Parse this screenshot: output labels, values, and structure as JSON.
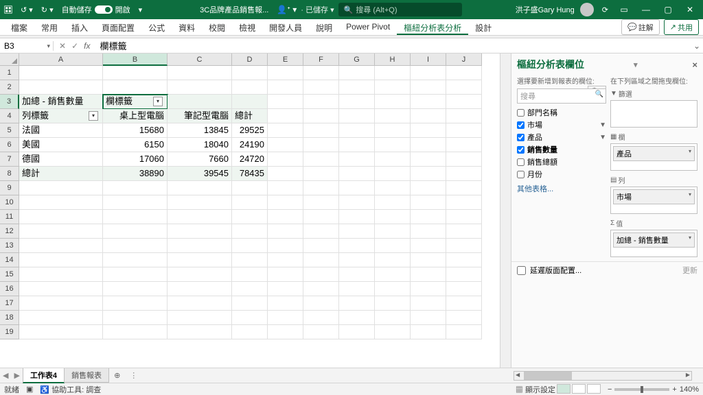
{
  "titlebar": {
    "autosave_label": "自動儲存",
    "autosave_state": "開啟",
    "filename": "3C品牌產品銷售報...",
    "saved": "已儲存",
    "search_placeholder": "搜尋 (Alt+Q)",
    "username": "洪子盛Gary Hung"
  },
  "tabs": {
    "file": "檔案",
    "home": "常用",
    "insert": "插入",
    "layout": "頁面配置",
    "formulas": "公式",
    "data": "資料",
    "review": "校閱",
    "view": "檢視",
    "developer": "開發人員",
    "help": "說明",
    "powerpivot": "Power Pivot",
    "analyze": "樞紐分析表分析",
    "design": "設計",
    "comments": "註解",
    "share": "共用"
  },
  "namebox": "B3",
  "formula": "欄標籤",
  "cols": {
    "A": {
      "w": 122
    },
    "B": {
      "w": 94
    },
    "C": {
      "w": 94
    },
    "D": {
      "w": 52
    },
    "E": {
      "w": 52
    },
    "F": {
      "w": 52
    },
    "G": {
      "w": 52
    },
    "H": {
      "w": 52
    },
    "I": {
      "w": 52
    },
    "J": {
      "w": 52
    }
  },
  "pivot": {
    "r3": {
      "a": "加總 - 銷售數量",
      "b": "欄標籤"
    },
    "r4": {
      "a": "列標籤",
      "b": "桌上型電腦",
      "c": "筆記型電腦",
      "d": "總計"
    },
    "r5": {
      "a": "法國",
      "b": "15680",
      "c": "13845",
      "d": "29525"
    },
    "r6": {
      "a": "美國",
      "b": "6150",
      "c": "18040",
      "d": "24190"
    },
    "r7": {
      "a": "德國",
      "b": "17060",
      "c": "7660",
      "d": "24720"
    },
    "r8": {
      "a": "總計",
      "b": "38890",
      "c": "39545",
      "d": "78435"
    }
  },
  "pane": {
    "title": "樞紐分析表欄位",
    "hint_left": "選擇要新增到報表的欄位:",
    "hint_right": "在下列區域之間拖曳欄位:",
    "search": "搜尋",
    "fields": {
      "dept": "部門名稱",
      "market": "市場",
      "product": "產品",
      "qty": "銷售數量",
      "amount": "銷售總額",
      "month": "月份"
    },
    "other": "其他表格...",
    "areas": {
      "filter": "篩選",
      "cols": "欄",
      "rows": "列",
      "values": "值"
    },
    "col_item": "產品",
    "row_item": "市場",
    "val_item": "加總 - 銷售數量",
    "defer": "延遲版面配置...",
    "update": "更新"
  },
  "sheets": {
    "s1": "工作表4",
    "s2": "銷售報表"
  },
  "status": {
    "ready": "就緒",
    "access": "協助工具: 調查",
    "display": "顯示設定",
    "zoom": "140%"
  }
}
